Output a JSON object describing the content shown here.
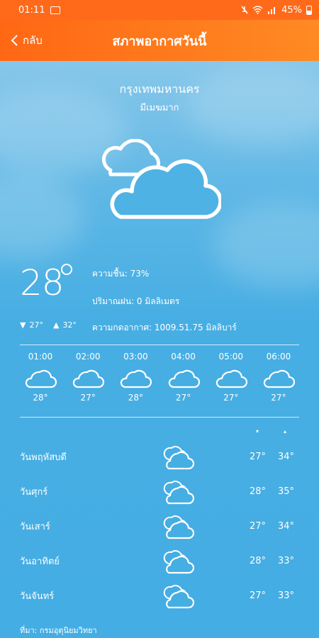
{
  "status_bar": {
    "time": "01:11",
    "battery": "45%"
  },
  "header": {
    "back_label": "กลับ",
    "title": "สภาพอากาศวันนี้"
  },
  "location": {
    "city": "กรุงเทพมหานคร",
    "description": "มีเมฆมาก"
  },
  "current": {
    "temp": "28",
    "min": "27°",
    "max": "32°",
    "humidity": "ความชื้น: 73%",
    "rain": "ปริมาณฝน: 0 มิลลิเมตร",
    "pressure": "ความกดอากาศ: 1009.51.75 มิลลิบาร์"
  },
  "hourly": [
    {
      "time": "01:00",
      "temp": "28°",
      "icon": "cloud-icon"
    },
    {
      "time": "02:00",
      "temp": "27°",
      "icon": "cloud-icon"
    },
    {
      "time": "03:00",
      "temp": "28°",
      "icon": "cloud-icon"
    },
    {
      "time": "04:00",
      "temp": "27°",
      "icon": "cloud-icon"
    },
    {
      "time": "05:00",
      "temp": "27°",
      "icon": "cloud-icon"
    },
    {
      "time": "06:00",
      "temp": "27°",
      "icon": "cloud-icon"
    }
  ],
  "daily_header": {
    "low_marker": "▾",
    "high_marker": "▴"
  },
  "daily": [
    {
      "day": "วันพฤหัสบดี",
      "low": "27°",
      "high": "34°",
      "icon": "clouds-icon"
    },
    {
      "day": "วันศุกร์",
      "low": "28°",
      "high": "35°",
      "icon": "clouds-icon"
    },
    {
      "day": "วันเสาร์",
      "low": "27°",
      "high": "34°",
      "icon": "clouds-icon"
    },
    {
      "day": "วันอาทิตย์",
      "low": "28°",
      "high": "33°",
      "icon": "clouds-icon"
    },
    {
      "day": "วันจันทร์",
      "low": "27°",
      "high": "33°",
      "icon": "clouds-icon"
    }
  ],
  "source": "ที่มา: กรมอุตุนิยมวิทยา",
  "colors": {
    "header_orange": "#ff6a1a",
    "sky_blue": "#45aee3"
  }
}
